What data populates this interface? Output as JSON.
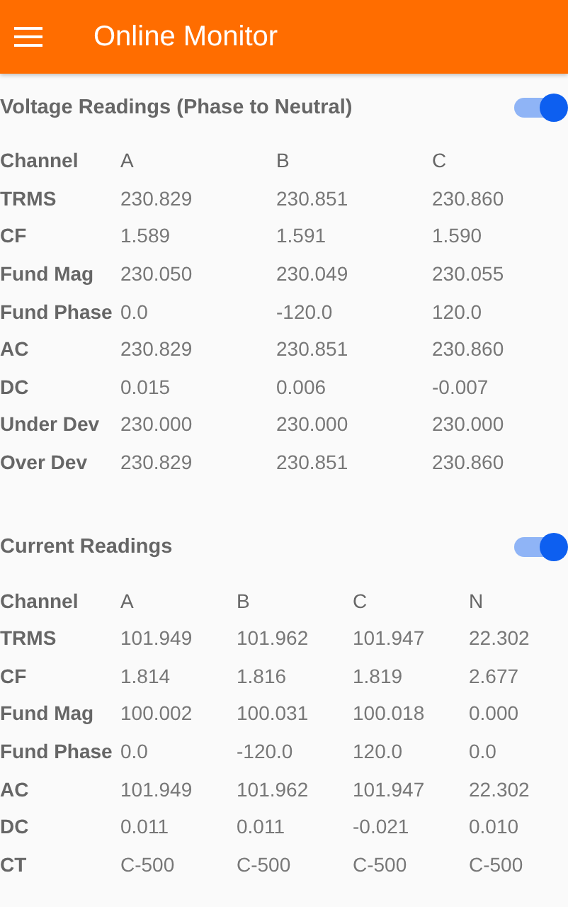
{
  "app_bar": {
    "title": "Online Monitor"
  },
  "sections": [
    {
      "title": "Voltage Readings (Phase to Neutral)",
      "toggle": {
        "on": true
      },
      "columns": [
        "Channel",
        "A",
        "B",
        "C"
      ],
      "rows": [
        {
          "label": "TRMS",
          "values": [
            "230.829",
            "230.851",
            "230.860"
          ]
        },
        {
          "label": "CF",
          "values": [
            "1.589",
            "1.591",
            "1.590"
          ]
        },
        {
          "label": "Fund Mag",
          "values": [
            "230.050",
            "230.049",
            "230.055"
          ]
        },
        {
          "label": "Fund Phase",
          "values": [
            "0.0",
            "-120.0",
            "120.0"
          ]
        },
        {
          "label": "AC",
          "values": [
            "230.829",
            "230.851",
            "230.860"
          ]
        },
        {
          "label": "DC",
          "values": [
            "0.015",
            "0.006",
            "-0.007"
          ]
        },
        {
          "label": "Under Dev",
          "values": [
            "230.000",
            "230.000",
            "230.000"
          ]
        },
        {
          "label": "Over Dev",
          "values": [
            "230.829",
            "230.851",
            "230.860"
          ]
        }
      ]
    },
    {
      "title": "Current Readings",
      "toggle": {
        "on": true
      },
      "columns": [
        "Channel",
        "A",
        "B",
        "C",
        "N"
      ],
      "rows": [
        {
          "label": "TRMS",
          "values": [
            "101.949",
            "101.962",
            "101.947",
            "22.302"
          ]
        },
        {
          "label": "CF",
          "values": [
            "1.814",
            "1.816",
            "1.819",
            "2.677"
          ]
        },
        {
          "label": "Fund Mag",
          "values": [
            "100.002",
            "100.031",
            "100.018",
            "0.000"
          ]
        },
        {
          "label": "Fund Phase",
          "values": [
            "0.0",
            "-120.0",
            "120.0",
            "0.0"
          ]
        },
        {
          "label": "AC",
          "values": [
            "101.949",
            "101.962",
            "101.947",
            "22.302"
          ]
        },
        {
          "label": "DC",
          "values": [
            "0.011",
            "0.011",
            "-0.021",
            "0.010"
          ]
        },
        {
          "label": "CT",
          "values": [
            "C-500",
            "C-500",
            "C-500",
            "C-500"
          ]
        }
      ]
    }
  ]
}
